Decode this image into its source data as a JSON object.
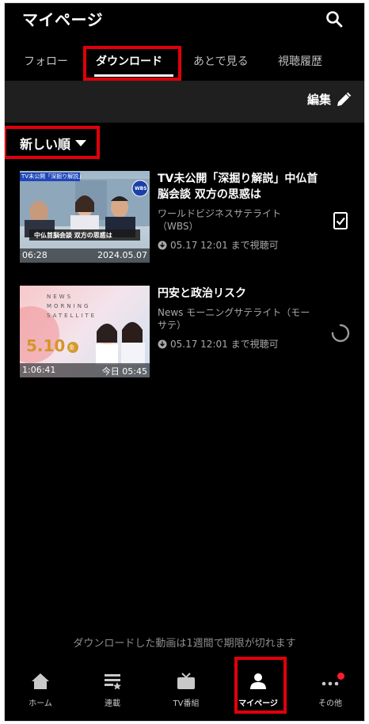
{
  "header": {
    "title": "マイページ",
    "icon": "search-icon"
  },
  "tabs": [
    {
      "label": "フォロー",
      "active": false
    },
    {
      "label": "ダウンロード",
      "active": true
    },
    {
      "label": "あとで見る",
      "active": false
    },
    {
      "label": "視聴履歴",
      "active": false
    }
  ],
  "toolbar": {
    "edit_label": "編集",
    "edit_icon": "pencil-icon"
  },
  "sort": {
    "label": "新しい順",
    "icon": "caret-down-icon"
  },
  "downloads": [
    {
      "title": "TV未公開「深掘り解説」中仏首脳会談 双方の思惑は",
      "channel": "ワールドビジネスサテライト（WBS）",
      "expiry": "05.17 12:01 まで視聴可",
      "duration": "06:28",
      "date": "2024.05.07",
      "thumb_banner": "TV未公開「深掘り解説」",
      "thumb_logo": "WBS",
      "thumb_caption": "中仏首脳会談 双方の思惑は",
      "status": "downloaded"
    },
    {
      "title": "円安と政治リスク",
      "channel": "News モーニングサテライト（モーサテ）",
      "expiry": "05.17 12:01 まで視聴可",
      "duration": "1:06:41",
      "date": "今日 05:45",
      "thumb_lines": [
        "NEWS",
        "MORNING",
        "SATELLITE"
      ],
      "thumb_date": "5.10",
      "thumb_weekday": "金",
      "status": "downloading"
    }
  ],
  "notice": "ダウンロードした動画は1週間で期限が切れます",
  "nav": [
    {
      "label": "ホーム",
      "icon": "home-icon"
    },
    {
      "label": "連載",
      "icon": "series-icon"
    },
    {
      "label": "TV番組",
      "icon": "tv-icon"
    },
    {
      "label": "マイページ",
      "icon": "person-icon",
      "active": true
    },
    {
      "label": "その他",
      "icon": "more-icon",
      "badge": true
    }
  ],
  "colors": {
    "highlight_box": "#e0000c",
    "badge": "#ff1a2e",
    "background": "#000000"
  }
}
